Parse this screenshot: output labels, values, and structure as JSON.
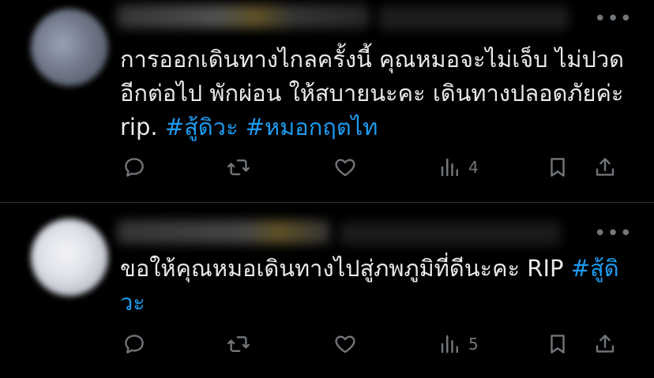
{
  "theme": {
    "background": "#000000",
    "text": "#e7e9ea",
    "muted": "#71767b",
    "accent": "#1d9bf0",
    "divider": "#2f3336"
  },
  "tweets": [
    {
      "text": "การออกเดินทางไกลครั้งนี้ คุณหมอจะไม่เจ็บ ไม่ปวดอีกต่อไป พักผ่อน ให้สบายนะคะ เดินทางปลอดภัยค่ะ rip. ",
      "hashtags": [
        "#สู้ดิวะ",
        "#หมอกฤตไท"
      ],
      "actions": {
        "reply_icon": "reply-icon",
        "retweet_icon": "retweet-icon",
        "like_icon": "heart-icon",
        "views_icon": "views-icon",
        "views": "4",
        "bookmark_icon": "bookmark-icon",
        "share_icon": "share-icon"
      },
      "more_label": "•••"
    },
    {
      "text": "ขอให้คุณหมอเดินทางไปสู่ภพภูมิที่ดีนะคะ RIP ",
      "hashtags": [
        "#สู้ดิวะ"
      ],
      "actions": {
        "reply_icon": "reply-icon",
        "retweet_icon": "retweet-icon",
        "like_icon": "heart-icon",
        "views_icon": "views-icon",
        "views": "5",
        "bookmark_icon": "bookmark-icon",
        "share_icon": "share-icon"
      },
      "more_label": "•••"
    }
  ]
}
